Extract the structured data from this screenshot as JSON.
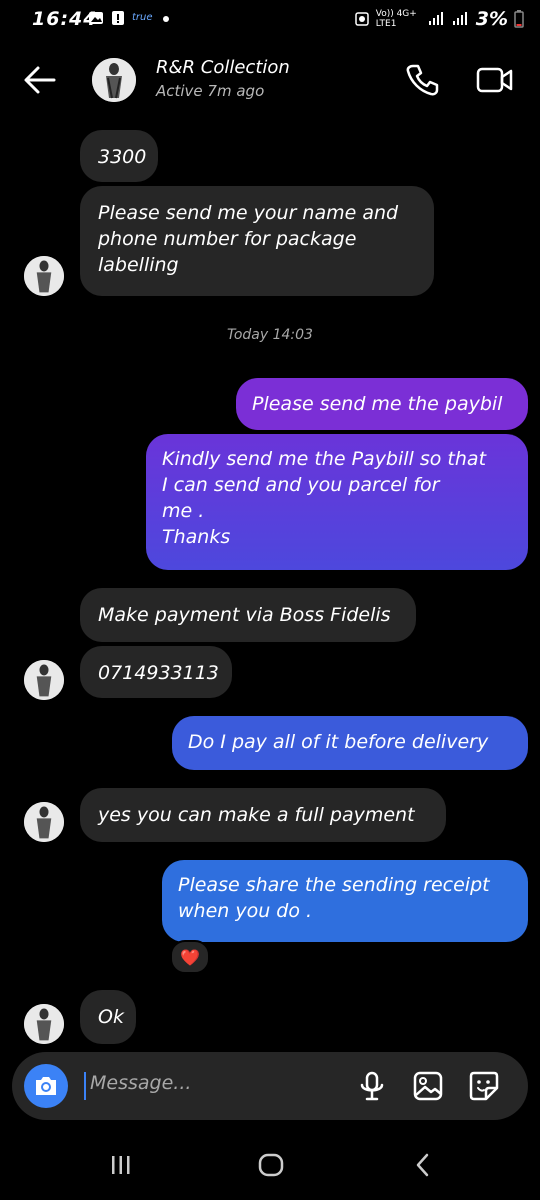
{
  "status_bar": {
    "time": "16:44",
    "true_label": "true",
    "network_label": "Vo)) 4G+ LTE1",
    "battery_percent": "3%"
  },
  "header": {
    "contact_name": "R&R Collection",
    "active_status": "Active 7m ago"
  },
  "messages": [
    {
      "direction": "incoming",
      "text": "3300"
    },
    {
      "direction": "incoming",
      "text": "Please send me your name and\nphone number for package\nlabelling"
    },
    {
      "direction": "timestamp",
      "text": "Today 14:03"
    },
    {
      "direction": "outgoing",
      "text": "Please send me the paybil"
    },
    {
      "direction": "outgoing",
      "text": "Kindly send me the Paybill so that\nI can send and you parcel for\nme .\nThanks"
    },
    {
      "direction": "incoming",
      "text": "Make payment via Boss Fidelis"
    },
    {
      "direction": "incoming",
      "text": "0714933113"
    },
    {
      "direction": "outgoing",
      "text": "Do I pay all of it before delivery"
    },
    {
      "direction": "incoming",
      "text": "yes you can make a full payment"
    },
    {
      "direction": "outgoing",
      "text": "Please share the sending receipt\nwhen you do ."
    },
    {
      "direction": "incoming",
      "text": "Ok"
    }
  ],
  "reaction": {
    "emoji": "❤️",
    "icon": "heart-reaction"
  },
  "composer": {
    "placeholder": "Message..."
  },
  "colors": {
    "outgoing_purple": "#7b2fd6",
    "outgoing_blue": "#3b5bdb",
    "incoming_bubble": "#262626",
    "camera_button": "#3b82f6",
    "background": "#000000"
  }
}
